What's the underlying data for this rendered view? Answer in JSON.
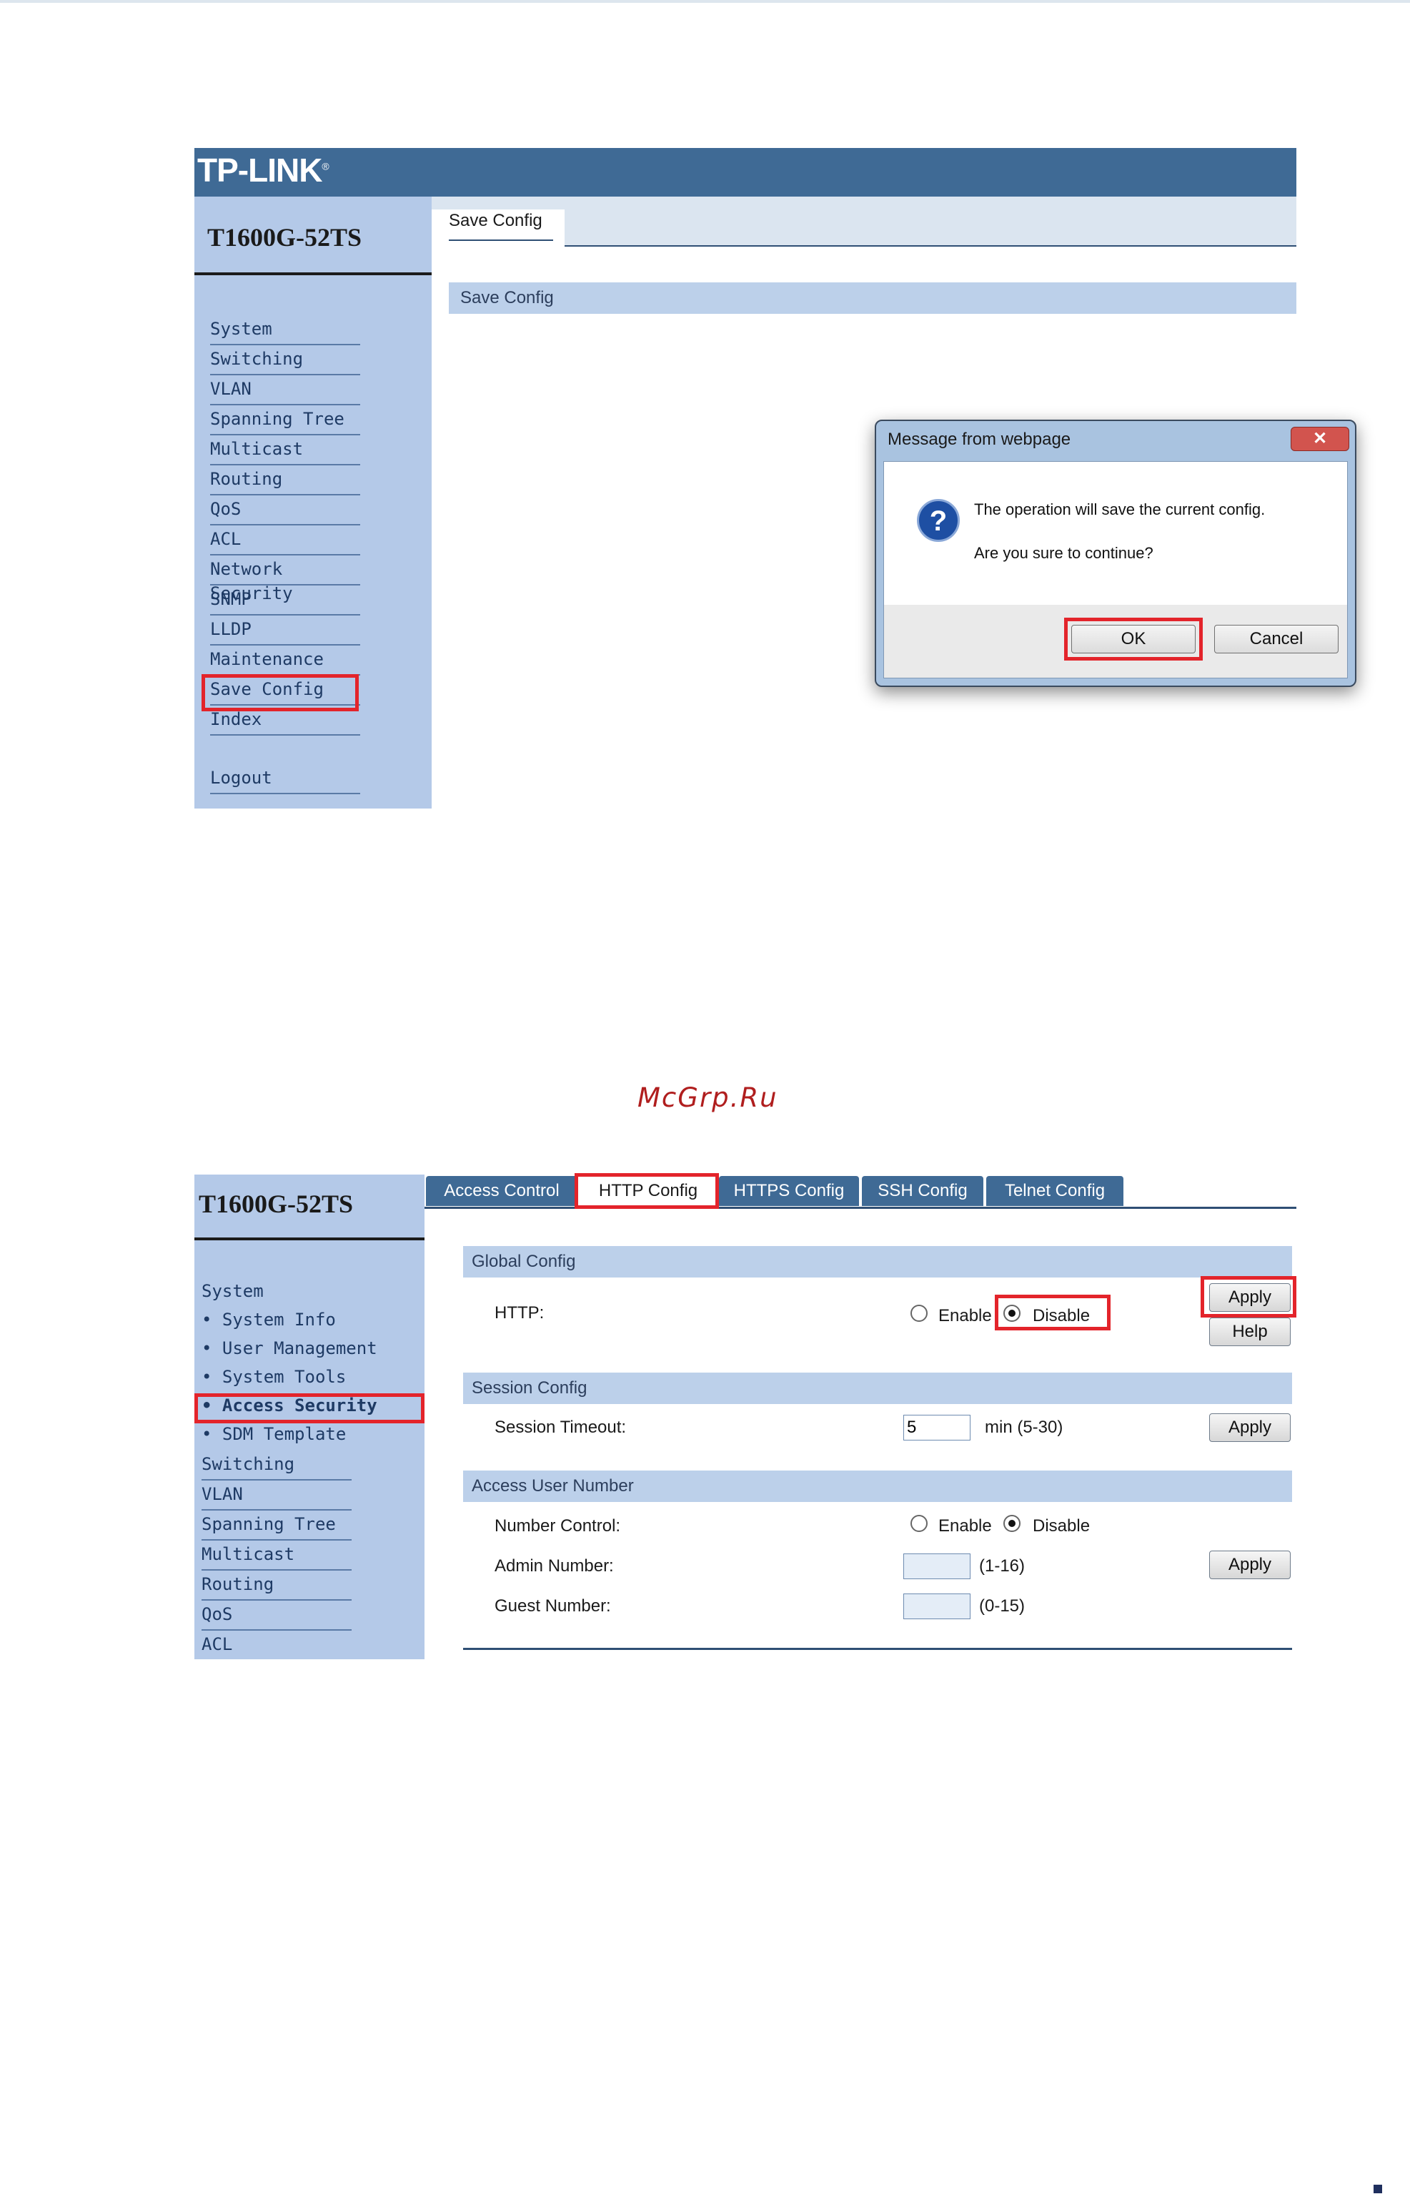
{
  "screenshot1": {
    "brand": "TP-LINK",
    "brand_mark": "®",
    "model": "T1600G-52TS",
    "nav": [
      "System",
      "Switching",
      "VLAN",
      "Spanning Tree",
      "Multicast",
      "Routing",
      "QoS",
      "ACL",
      "Network Security",
      "SNMP",
      "LLDP",
      "Maintenance",
      "Save Config",
      "Index"
    ],
    "logout": "Logout",
    "tab": "Save Config",
    "section": "Save Config",
    "dialog": {
      "title": "Message from webpage",
      "close": "✕",
      "message": "The operation will save the current config.",
      "question": "Are you sure to continue?",
      "ok": "OK",
      "cancel": "Cancel",
      "icon": "?"
    }
  },
  "watermark": "McGrp.Ru",
  "screenshot2": {
    "model": "T1600G-52TS",
    "nav": [
      {
        "label": "System"
      },
      {
        "label": "• System Info"
      },
      {
        "label": "• User Management"
      },
      {
        "label": "• System Tools"
      },
      {
        "label": "• Access Security"
      },
      {
        "label": "• SDM Template"
      },
      {
        "label": "Switching"
      },
      {
        "label": "VLAN"
      },
      {
        "label": "Spanning Tree"
      },
      {
        "label": "Multicast"
      },
      {
        "label": "Routing"
      },
      {
        "label": "QoS"
      },
      {
        "label": "ACL"
      }
    ],
    "tabs": [
      "Access Control",
      "HTTP Config",
      "HTTPS Config",
      "SSH Config",
      "Telnet Config"
    ],
    "global": {
      "title": "Global Config",
      "http_label": "HTTP:",
      "enable": "Enable",
      "disable": "Disable",
      "selected": "Disable",
      "apply": "Apply",
      "help": "Help"
    },
    "session": {
      "title": "Session Config",
      "label": "Session Timeout:",
      "value": "5",
      "unit": "min (5-30)",
      "apply": "Apply"
    },
    "access": {
      "title": "Access User Number",
      "control_label": "Number Control:",
      "enable": "Enable",
      "disable": "Disable",
      "selected": "Disable",
      "admin_label": "Admin Number:",
      "admin_range": "(1-16)",
      "guest_label": "Guest Number:",
      "guest_range": "(0-15)",
      "apply": "Apply"
    }
  }
}
